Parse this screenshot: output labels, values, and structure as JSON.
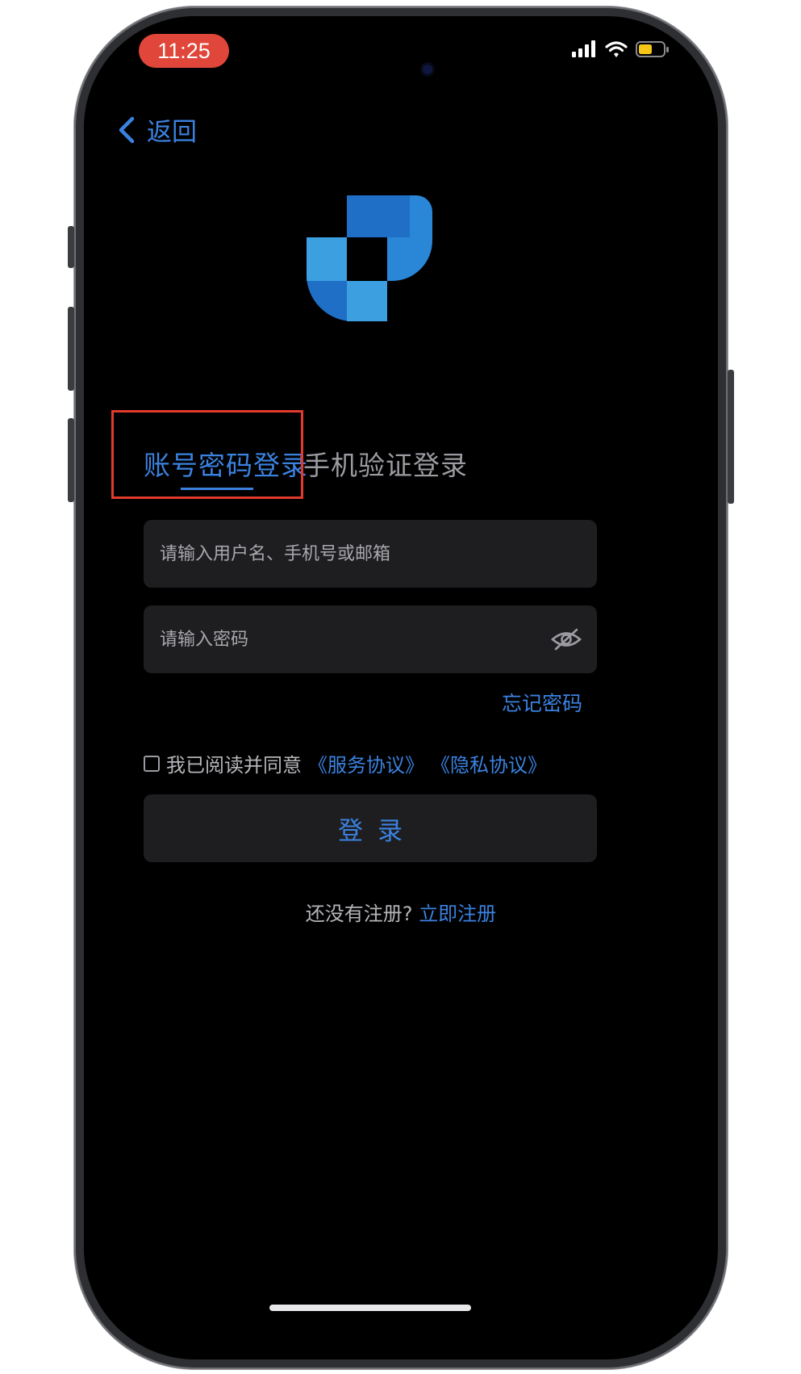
{
  "status_bar": {
    "time": "11:25",
    "icons": [
      "cellular-signal-icon",
      "wifi-icon",
      "battery-icon"
    ],
    "time_pill_color": "#e0473a",
    "battery_color": "#f5c518"
  },
  "nav": {
    "back_label": "返回",
    "back_icon": "chevron-left-icon"
  },
  "logo": {
    "colors": [
      "#1f6fc7",
      "#3b9fe0",
      "#2a86d6"
    ]
  },
  "tabs": [
    {
      "label": "账号密码登录",
      "active": true
    },
    {
      "label": "手机验证登录",
      "active": false
    }
  ],
  "form": {
    "username_placeholder": "请输入用户名、手机号或邮箱",
    "password_placeholder": "请输入密码",
    "password_toggle_icon": "eye-off-icon",
    "forgot_label": "忘记密码"
  },
  "agreement": {
    "checked": false,
    "text": "我已阅读并同意",
    "service_link": "《服务协议》",
    "privacy_link": "《隐私协议》"
  },
  "login_label": "登录",
  "register": {
    "prompt": "还没有注册?",
    "link": "立即注册"
  },
  "colors": {
    "accent": "#3b82e0",
    "background": "#000000",
    "field_bg": "#1e1e21",
    "annotation_red": "#e23a2c"
  }
}
